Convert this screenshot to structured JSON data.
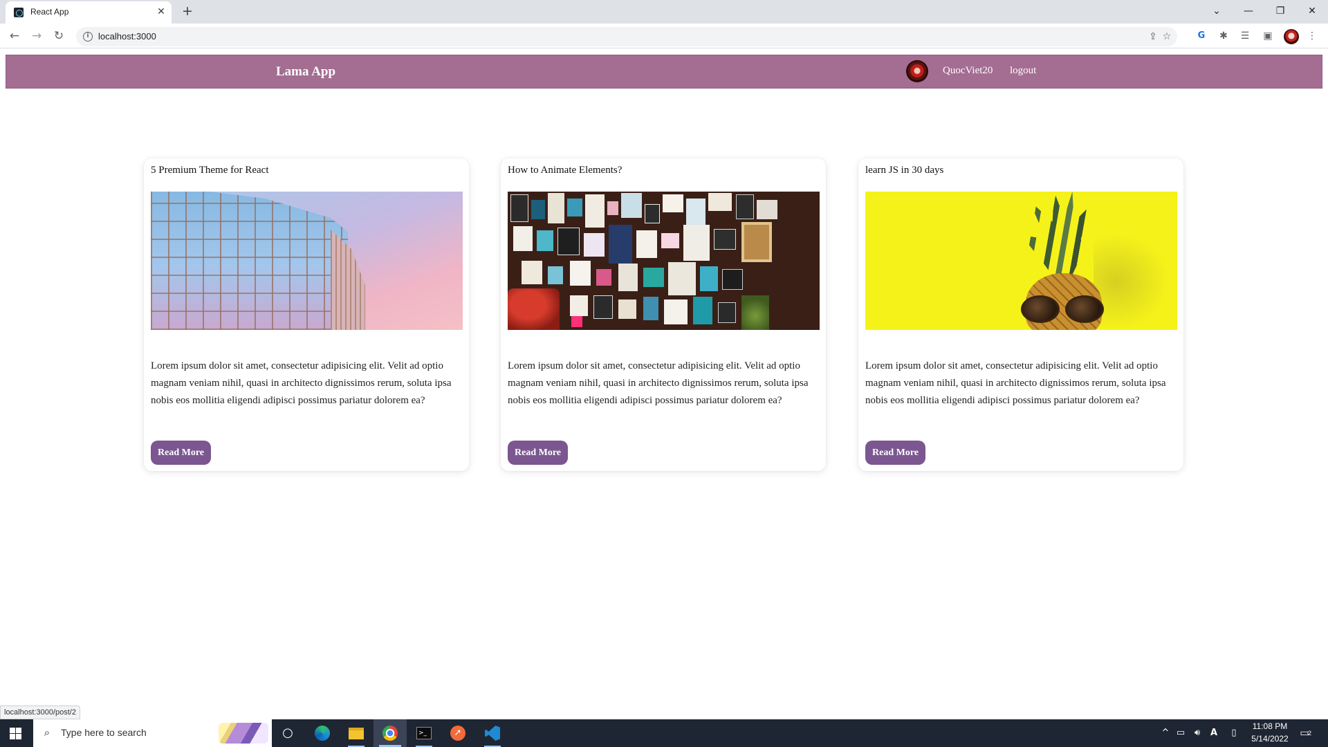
{
  "browser": {
    "tab_title": "React App",
    "tab_close_glyph": "✕",
    "new_tab_glyph": "+",
    "url": "localhost:3000",
    "status_url": "localhost:3000/post/2",
    "window_controls": {
      "tabsearch": "⌄",
      "minimize": "—",
      "restore": "❐",
      "close": "✕"
    },
    "nav": {
      "back": "←",
      "forward": "→",
      "reload": "↻"
    },
    "info_glyph": "i",
    "icons": [
      "info-icon",
      "share-icon",
      "star-icon",
      "translate-icon",
      "extensions-icon",
      "reading-list-icon",
      "side-panel-icon",
      "menu-icon"
    ]
  },
  "app": {
    "brand_color": "#a46d92",
    "button_color": "#7b5690",
    "logo": "Lama App",
    "username": "QuocViet20",
    "logout": "logout"
  },
  "posts": [
    {
      "title": "5 Premium Theme for React",
      "description": "Lorem ipsum dolor sit amet, consectetur adipisicing elit. Velit ad optio magnam veniam nihil, quasi in architecto dignissimos rerum, soluta ipsa nobis eos mollitia eligendi adipisci possimus pariatur dolorem ea?",
      "button": "Read More"
    },
    {
      "title": "How to Animate Elements?",
      "description": "Lorem ipsum dolor sit amet, consectetur adipisicing elit. Velit ad optio magnam veniam nihil, quasi in architecto dignissimos rerum, soluta ipsa nobis eos mollitia eligendi adipisci possimus pariatur dolorem ea?",
      "button": "Read More"
    },
    {
      "title": "learn JS in 30 days",
      "description": "Lorem ipsum dolor sit amet, consectetur adipisicing elit. Velit ad optio magnam veniam nihil, quasi in architecto dignissimos rerum, soluta ipsa nobis eos mollitia eligendi adipisci possimus pariatur dolorem ea?",
      "button": "Read More"
    }
  ],
  "taskbar": {
    "search_placeholder": "Type here to search",
    "search_glyph": "⌕",
    "time": "11:08 PM",
    "date": "5/14/2022",
    "notification_count": "2",
    "apps": [
      "task-view",
      "edge",
      "file-explorer",
      "chrome",
      "terminal",
      "postman",
      "vscode"
    ]
  }
}
